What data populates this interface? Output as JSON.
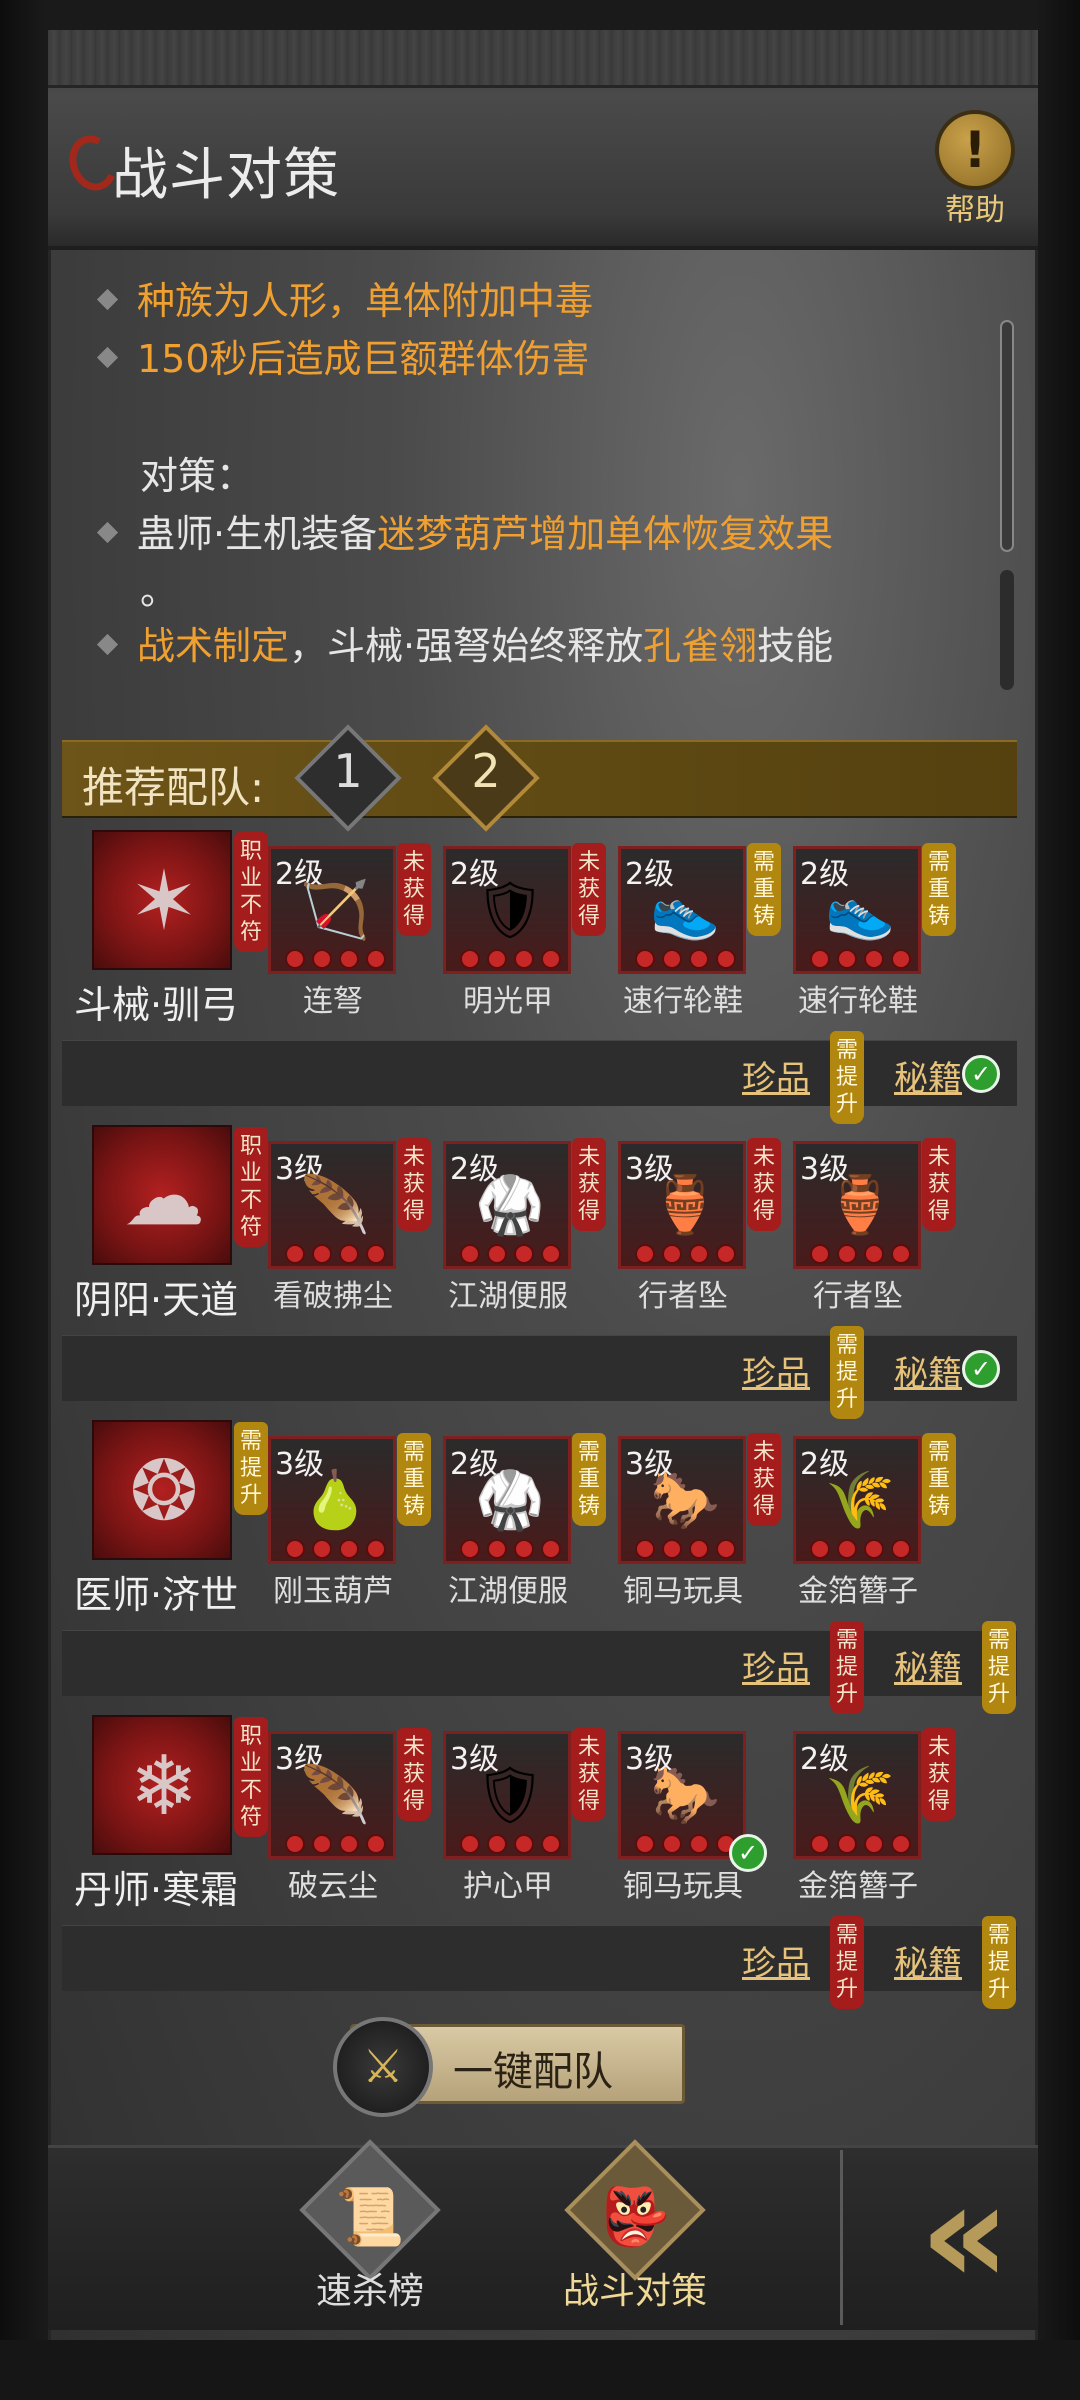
{
  "header": {
    "title": "战斗对策",
    "help_label": "帮助"
  },
  "info": {
    "lines": [
      {
        "pre": "",
        "hl": "种族为人形，单体附加中毒",
        "post": ""
      },
      {
        "pre": "",
        "hl": "150秒后造成巨额群体伤害",
        "post": ""
      },
      {
        "pre": "对策：",
        "hl": "",
        "post": ""
      },
      {
        "pre": "蛊师·生机装备",
        "hl": "迷梦葫芦增加单体恢复效果",
        "post": ""
      },
      {
        "pre": "。",
        "hl": "",
        "post": ""
      },
      {
        "hl1": "战术制定",
        "mid": "，斗械·强弩始终释放",
        "hl2": "孔雀翎",
        "post": "技能"
      }
    ]
  },
  "recommend": {
    "title": "推荐配队:",
    "tabs": [
      "1",
      "2"
    ],
    "active_tab": "2"
  },
  "teams": [
    {
      "name": "斗械·驯弓",
      "status": "职业不符",
      "status_color": "red",
      "items": [
        {
          "level": "2级",
          "name": "连弩",
          "tag": "未获得",
          "tag_color": "red",
          "icon": "crossbow-icon",
          "glyph": "🏹"
        },
        {
          "level": "2级",
          "name": "明光甲",
          "tag": "未获得",
          "tag_color": "red",
          "icon": "armor-icon",
          "glyph": "🛡"
        },
        {
          "level": "2级",
          "name": "速行轮鞋",
          "tag": "需重铸",
          "tag_color": "gold",
          "icon": "boots-icon",
          "glyph": "👟"
        },
        {
          "level": "2级",
          "name": "速行轮鞋",
          "tag": "需重铸",
          "tag_color": "gold",
          "icon": "boots-icon",
          "glyph": "👟"
        }
      ],
      "treasure": "珍品",
      "treasure_tag": "需提升",
      "treasure_tag_color": "gold",
      "secret": "秘籍",
      "secret_tag": "",
      "secret_ok": true
    },
    {
      "name": "阴阳·天道",
      "status": "职业不符",
      "status_color": "red",
      "items": [
        {
          "level": "3级",
          "name": "看破拂尘",
          "tag": "未获得",
          "tag_color": "red",
          "icon": "whisk-icon",
          "glyph": "🪶"
        },
        {
          "level": "2级",
          "name": "江湖便服",
          "tag": "未获得",
          "tag_color": "red",
          "icon": "robe-icon",
          "glyph": "🥋"
        },
        {
          "level": "3级",
          "name": "行者坠",
          "tag": "未获得",
          "tag_color": "red",
          "icon": "pendant-icon",
          "glyph": "🏺"
        },
        {
          "level": "3级",
          "name": "行者坠",
          "tag": "未获得",
          "tag_color": "red",
          "icon": "pendant-icon",
          "glyph": "🏺"
        }
      ],
      "treasure": "珍品",
      "treasure_tag": "需提升",
      "treasure_tag_color": "gold",
      "secret": "秘籍",
      "secret_tag": "",
      "secret_ok": true
    },
    {
      "name": "医师·济世",
      "status": "需提升",
      "status_color": "gold",
      "items": [
        {
          "level": "3级",
          "name": "刚玉葫芦",
          "tag": "需重铸",
          "tag_color": "gold",
          "icon": "gourd-icon",
          "glyph": "🍐"
        },
        {
          "level": "2级",
          "name": "江湖便服",
          "tag": "需重铸",
          "tag_color": "gold",
          "icon": "robe-icon",
          "glyph": "🥋"
        },
        {
          "level": "3级",
          "name": "铜马玩具",
          "tag": "未获得",
          "tag_color": "red",
          "icon": "horse-toy-icon",
          "glyph": "🐎"
        },
        {
          "level": "2级",
          "name": "金箔簪子",
          "tag": "需重铸",
          "tag_color": "gold",
          "icon": "hairpin-icon",
          "glyph": "🌾"
        }
      ],
      "treasure": "珍品",
      "treasure_tag": "需提升",
      "treasure_tag_color": "red",
      "secret": "秘籍",
      "secret_tag": "需提升",
      "secret_tag_color": "gold",
      "secret_ok": false
    },
    {
      "name": "丹师·寒霜",
      "status": "职业不符",
      "status_color": "red",
      "items": [
        {
          "level": "3级",
          "name": "破云尘",
          "tag": "未获得",
          "tag_color": "red",
          "icon": "whisk-icon",
          "glyph": "🪶"
        },
        {
          "level": "3级",
          "name": "护心甲",
          "tag": "未获得",
          "tag_color": "red",
          "icon": "armor-icon",
          "glyph": "🛡"
        },
        {
          "level": "3级",
          "name": "铜马玩具",
          "tag": "",
          "tag_color": "",
          "icon": "horse-toy-icon",
          "glyph": "🐎",
          "ok": true
        },
        {
          "level": "2级",
          "name": "金箔簪子",
          "tag": "未获得",
          "tag_color": "red",
          "icon": "hairpin-icon",
          "glyph": "🌾"
        }
      ],
      "treasure": "珍品",
      "treasure_tag": "需提升",
      "treasure_tag_color": "red",
      "secret": "秘籍",
      "secret_tag": "需提升",
      "secret_tag_color": "gold",
      "secret_ok": false
    }
  ],
  "one_key_label": "一键配队",
  "bottom_nav": [
    {
      "label": "速杀榜",
      "icon": "scroll-icon",
      "glyph": "📜",
      "active": false
    },
    {
      "label": "战斗对策",
      "icon": "strategy-icon",
      "glyph": "👺",
      "active": true
    }
  ],
  "back_glyph": "«"
}
